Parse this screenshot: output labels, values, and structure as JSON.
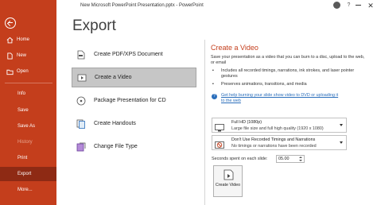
{
  "window": {
    "title": "New Microsoft PowerPoint Presentation.pptx  -  PowerPoint",
    "help_glyph": "?",
    "close_glyph": "✕"
  },
  "sidebar": {
    "items": [
      {
        "label": "Home",
        "icon": "home-icon"
      },
      {
        "label": "New",
        "icon": "new-document-icon"
      },
      {
        "label": "Open",
        "icon": "folder-open-icon"
      },
      {
        "label": "Info"
      },
      {
        "label": "Save"
      },
      {
        "label": "Save As"
      },
      {
        "label": "History"
      },
      {
        "label": "Print"
      },
      {
        "label": "Export"
      },
      {
        "label": "More..."
      }
    ],
    "selected": "Export",
    "disabled": "History",
    "colors": {
      "background": "#c43e1c",
      "selected": "#8e2a14"
    }
  },
  "main": {
    "heading": "Export",
    "options": [
      {
        "label": "Create PDF/XPS Document",
        "icon": "pdf-document-icon"
      },
      {
        "label": "Create a Video",
        "icon": "video-icon"
      },
      {
        "label": "Package Presentation for CD",
        "icon": "cd-icon"
      },
      {
        "label": "Create Handouts",
        "icon": "handouts-icon"
      },
      {
        "label": "Change File Type",
        "icon": "file-type-icon"
      }
    ],
    "selected": "Create a Video"
  },
  "video_panel": {
    "heading": "Create a Video",
    "description": "Save your presentation as a video that you can burn to a disc, upload to the web, or email",
    "bullets": [
      "Includes all recorded timings, narrations, ink strokes, and laser pointer gestures",
      "Preserves animations, transitions, and media"
    ],
    "help_link": "Get help burning your slide show video to DVD or uploading it to the web",
    "quality": {
      "main": "Full HD (1080p)",
      "sub": "Large file size and full high quality (1920 x 1080)"
    },
    "timings": {
      "main": "Don't Use Recorded Timings and Narrations",
      "sub": "No timings or narrations have been recorded"
    },
    "seconds_label": "Seconds spent on each slide:",
    "seconds_value": "05.00",
    "create_button": "Create Video",
    "accent_color": "#c43e1c",
    "link_color": "#2a6ebb"
  }
}
